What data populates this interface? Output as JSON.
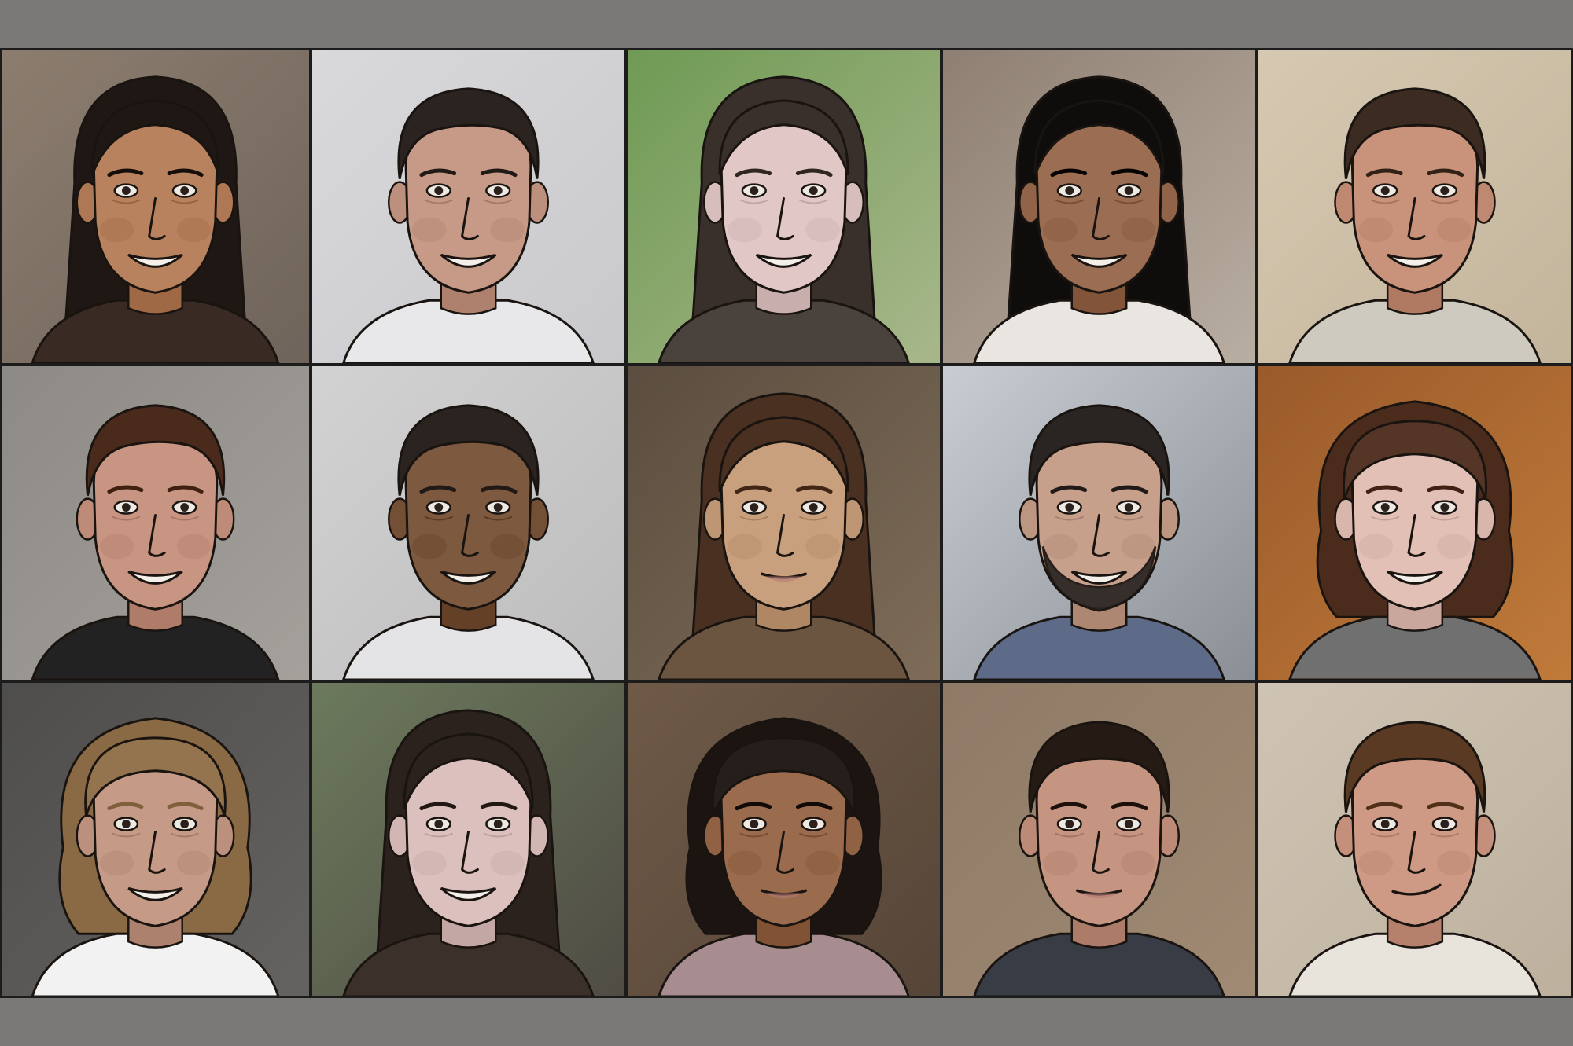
{
  "portraits": [
    {
      "bg": "#8c7d6e",
      "bg2": "#6f645b",
      "skin": "#b9825f",
      "hair": "#1e1714",
      "shirt": "#3a2a24",
      "expression": "smile",
      "hair_style": "long"
    },
    {
      "bg": "#d9d9dc",
      "bg2": "#c9c9cc",
      "skin": "#c69a86",
      "hair": "#2a2320",
      "shirt": "#e8e8ea",
      "expression": "smile",
      "hair_style": "short"
    },
    {
      "bg": "#6f9a54",
      "bg2": "#a8b78b",
      "skin": "#e2c7c7",
      "hair": "#3a302b",
      "shirt": "#4a423c",
      "expression": "smile",
      "hair_style": "long"
    },
    {
      "bg": "#8e7f72",
      "bg2": "#b9aea2",
      "skin": "#9b6d52",
      "hair": "#0f0c0c",
      "shirt": "#e9e6e2",
      "expression": "smile",
      "hair_style": "long"
    },
    {
      "bg": "#d7c9b1",
      "bg2": "#c3b59c",
      "skin": "#c9927a",
      "hair": "#3b2b20",
      "shirt": "#cfcac0",
      "expression": "smile",
      "hair_style": "short"
    },
    {
      "bg": "#8d8985",
      "bg2": "#a4a09b",
      "skin": "#c79581",
      "hair": "#4a2a1a",
      "shirt": "#222222",
      "expression": "smile",
      "hair_style": "short"
    },
    {
      "bg": "#d3d2d3",
      "bg2": "#bdbcbd",
      "skin": "#7d5940",
      "hair": "#2b231f",
      "shirt": "#e4e4e6",
      "expression": "smile",
      "hair_style": "short"
    },
    {
      "bg": "#5b4d3f",
      "bg2": "#7e6c58",
      "skin": "#c9a07d",
      "hair": "#4a3020",
      "shirt": "#6c5540",
      "expression": "neutral",
      "hair_style": "long"
    },
    {
      "bg": "#c9cdd3",
      "bg2": "#8a8f96",
      "skin": "#c7a08c",
      "hair": "#2a2523",
      "shirt": "#5d6b88",
      "expression": "beard",
      "hair_style": "short"
    },
    {
      "bg": "#9a5a2a",
      "bg2": "#c07a3a",
      "skin": "#e2c0b5",
      "hair": "#4b2c1c",
      "shirt": "#707070",
      "expression": "smile",
      "hair_style": "curly"
    },
    {
      "bg": "#4e4d4b",
      "bg2": "#656361",
      "skin": "#c59a86",
      "hair": "#8a6a45",
      "shirt": "#f2f2f2",
      "expression": "smile",
      "hair_style": "curly"
    },
    {
      "bg": "#6c7a5c",
      "bg2": "#4f4c44",
      "skin": "#dcc0bd",
      "hair": "#2b221e",
      "shirt": "#3c302a",
      "expression": "smile",
      "hair_style": "long"
    },
    {
      "bg": "#6f5a47",
      "bg2": "#564538",
      "skin": "#9b6b4e",
      "hair": "#1c1410",
      "shirt": "#a88d90",
      "expression": "neutral",
      "hair_style": "curly"
    },
    {
      "bg": "#8e7a66",
      "bg2": "#a08a74",
      "skin": "#c69581",
      "hair": "#251a14",
      "shirt": "#383c44",
      "expression": "neutral",
      "hair_style": "short"
    },
    {
      "bg": "#cfc4b4",
      "bg2": "#bdb09d",
      "skin": "#cf9a85",
      "hair": "#5a3a22",
      "shirt": "#e8e4dc",
      "expression": "smirk",
      "hair_style": "short"
    }
  ]
}
